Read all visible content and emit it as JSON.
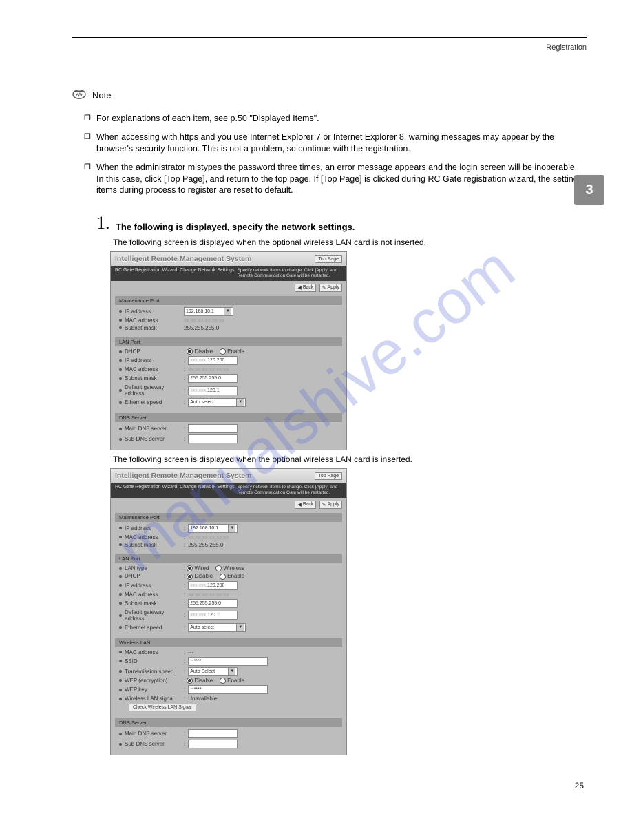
{
  "header_right": "Registration",
  "note_label": "Note",
  "bullets": [
    "For explanations of each item, see p.50 \"Displayed Items\".",
    "When accessing with https and you use Internet Explorer 7 or Internet Explorer 8, warning messages may appear by the browser's security function. This is not a problem, so continue with the registration.",
    "When the administrator mistypes the password three times, an error message appears and the login screen will be inoperable. In this case, click [Top Page], and return to the top page. If [Top Page] is clicked during RC Gate registration wizard, the setting items during process to register are reset to default."
  ],
  "step_num": "1.",
  "step_text": "The following is displayed, specify the network settings.",
  "step_sub": "The following screen is displayed when the optional wireless LAN card is not inserted.",
  "step_sub2": "The following screen is displayed when the optional wireless LAN card is inserted.",
  "shot_title": "Intelligent Remote Management System",
  "top_page": "Top Page",
  "subbar_left": "RC Gate Registration Wizard: Change Network Settings",
  "subbar_right": "Specify network items to change.\nClick [Apply] and Remote Communication Gate will be restarted.",
  "btn_back": "Back",
  "btn_apply": "Apply",
  "sections": {
    "maint": "Maintenance Port",
    "lan": "LAN Port",
    "dns": "DNS Server",
    "wlan": "Wireless LAN"
  },
  "labels": {
    "ip": "IP address",
    "mac": "MAC address",
    "subnet": "Subnet mask",
    "dhcp": "DHCP",
    "gateway": "Default gateway address",
    "espeed": "Ethernet speed",
    "maindns": "Main DNS server",
    "subdns": "Sub DNS server",
    "lantype": "LAN type",
    "ssid": "SSID",
    "tspeed": "Transmission speed",
    "wep": "WEP (encryption)",
    "wepkey": "WEP key",
    "wsig": "Wireless LAN signal",
    "wsig_btn": "Check Wireless LAN Signal"
  },
  "values": {
    "maint_ip": "192.168.10.1",
    "maint_subnet": "255.255.255.0",
    "lan_ip": ".120.200",
    "lan_subnet": "255.255.255.0",
    "gateway": ".120.1",
    "espeed": "Auto select",
    "tspeed": "Auto Select",
    "ssid": "******",
    "wepkey": "******",
    "wsig": "Unavailable",
    "disable": "Disable",
    "enable": "Enable",
    "wired": "Wired",
    "wireless": "Wireless",
    "dash": "---"
  },
  "page_tab": "3",
  "page_num": "25",
  "watermark": "manualshive.com"
}
